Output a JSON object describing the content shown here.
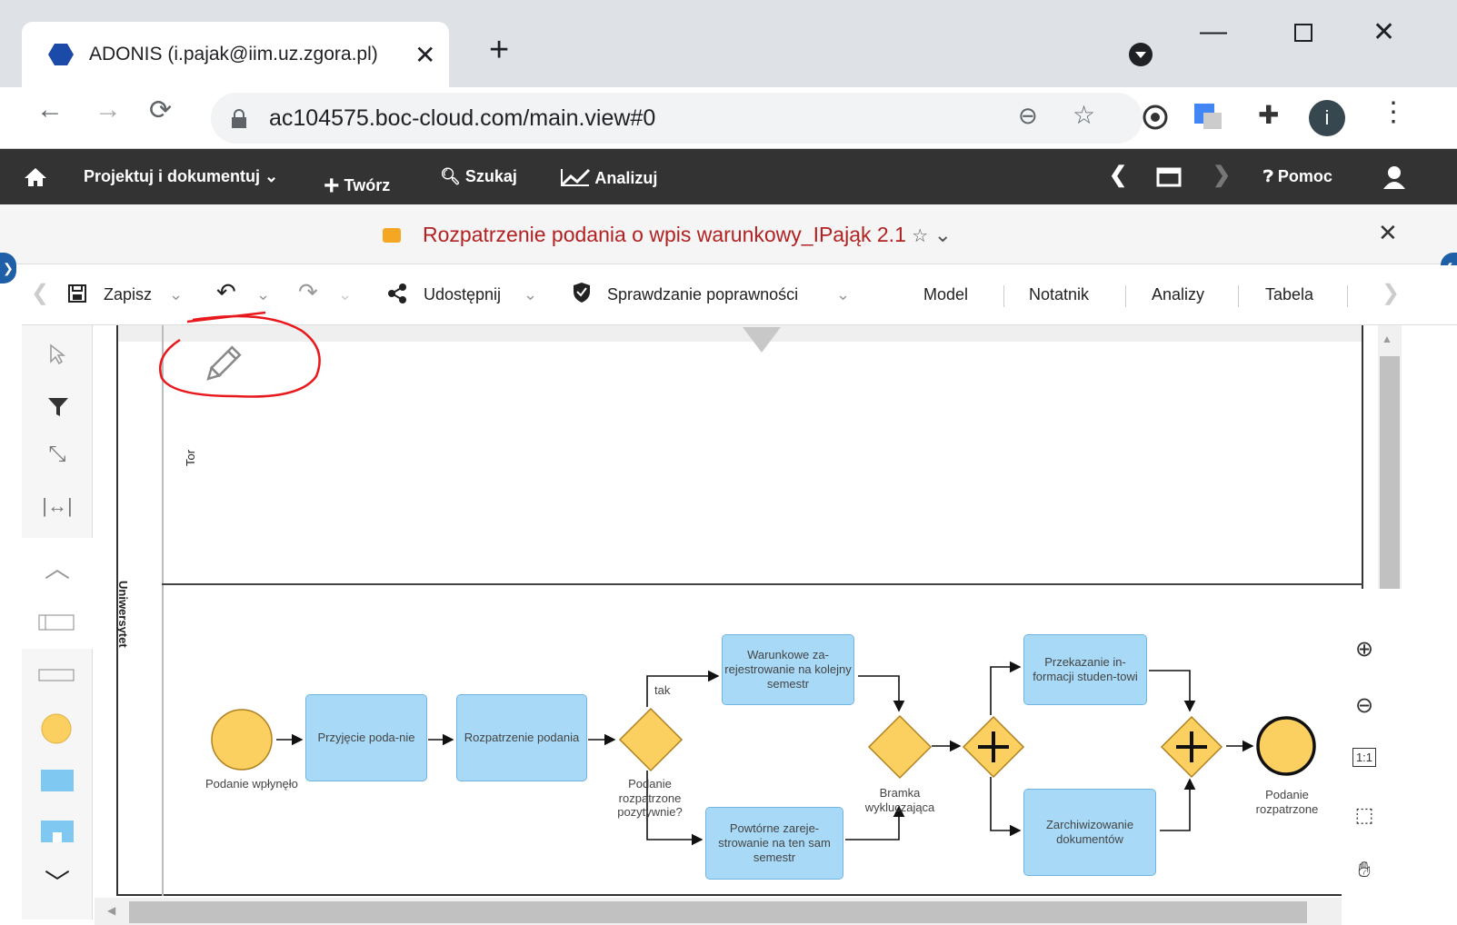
{
  "browser": {
    "tab_title": "ADONIS (i.pajak@iim.uz.zgora.pl)",
    "tab_close": "✕",
    "new_tab": "+",
    "url": "ac104575.boc-cloud.com/main.view#0",
    "profile_initial": "i"
  },
  "menubar": {
    "design": "Projektuj i dokumentuj",
    "create": "Twórz",
    "search": "Szukaj",
    "analyze": "Analizuj",
    "help": "Pomoc"
  },
  "model": {
    "title": "Rozpatrzenie podania o wpis warunkowy_IPająk 2.1"
  },
  "toolbar": {
    "save": "Zapisz",
    "share": "Udostępnij",
    "check": "Sprawdzanie poprawności",
    "model": "Model",
    "notebook": "Notatnik",
    "analyses": "Analizy",
    "table": "Tabela"
  },
  "diagram": {
    "pool": "Uniwersytet",
    "lane": "Tor",
    "start_event": "Podanie wpłynęło",
    "task_receive": "Przyjęcie poda-nie",
    "task_consider": "Rozpatrzenie podania",
    "gateway_question": "Podanie rozpatrzone pozytywnie?",
    "flow_yes": "tak",
    "task_conditional": "Warunkowe za-rejestrowanie na kolejny semestr",
    "task_repeat": "Powtórne zareje-strowanie na ten sam semestr",
    "gateway_exclusive": "Bramka wykluczająca",
    "task_inform": "Przekazanie in-formacji studen-towi",
    "task_archive": "Zarchiwizowanie dokumentów",
    "end_event": "Podanie rozpatrzone"
  },
  "zoom": {
    "fit": "1:1"
  },
  "colors": {
    "menubar": "#333333",
    "task_fill": "#a8daf7",
    "gateway_fill": "#fcd060",
    "event_fill": "#fcd060",
    "annotation": "#e8191c",
    "title_text": "#b22222"
  }
}
